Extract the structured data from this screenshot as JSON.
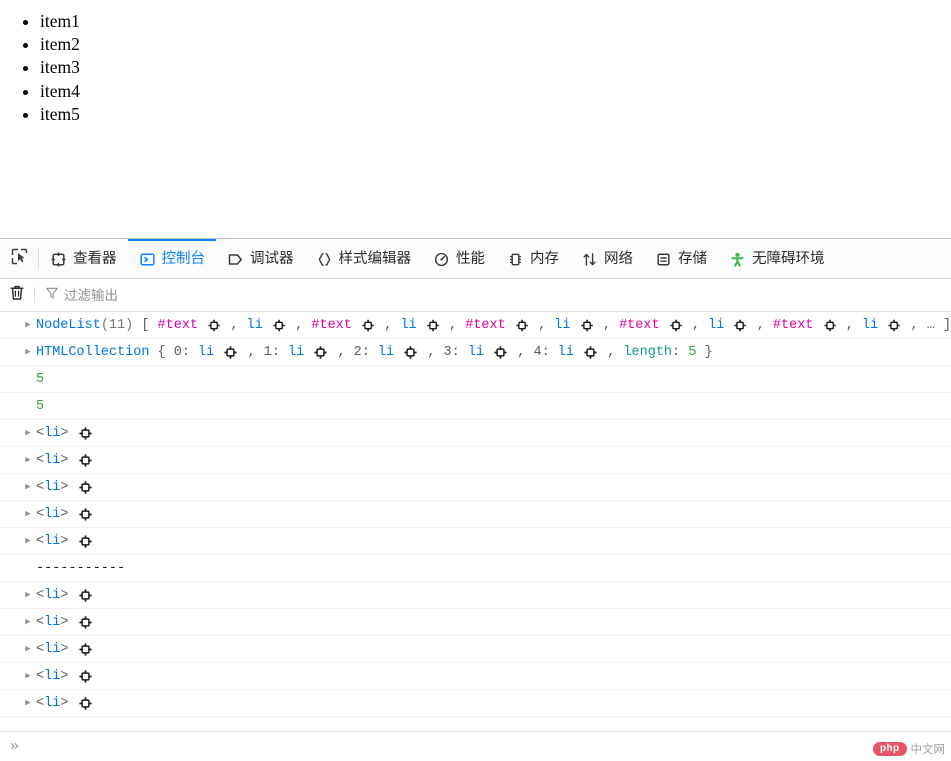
{
  "page": {
    "list_items": [
      "item1",
      "item2",
      "item3",
      "item4",
      "item5"
    ]
  },
  "devtools": {
    "picker_icon": "element-picker-icon",
    "tabs": [
      {
        "label": "查看器",
        "icon": "inspector-target-icon",
        "active": false
      },
      {
        "label": "控制台",
        "icon": "console-prompt-icon",
        "active": true
      },
      {
        "label": "调试器",
        "icon": "debugger-icon",
        "active": false
      },
      {
        "label": "样式编辑器",
        "icon": "braces-icon",
        "active": false
      },
      {
        "label": "性能",
        "icon": "gauge-icon",
        "active": false
      },
      {
        "label": "内存",
        "icon": "memory-icon",
        "active": false
      },
      {
        "label": "网络",
        "icon": "arrows-updown-icon",
        "active": false
      },
      {
        "label": "存储",
        "icon": "storage-icon",
        "active": false
      },
      {
        "label": "无障碍环境",
        "icon": "accessibility-person-icon",
        "active": false
      }
    ],
    "filterbar": {
      "trash_icon": "trash-icon",
      "funnel_icon": "filter-funnel-icon",
      "filter_placeholder": "过滤输出",
      "filter_value": ""
    },
    "prompt": {
      "chevron": "»",
      "value": "",
      "placeholder": ""
    }
  },
  "console": {
    "rows": [
      {
        "type": "object",
        "expandable": true,
        "tokens": [
          {
            "text": "NodeList",
            "cls": "t-obj"
          },
          {
            "text": "(11)",
            "cls": "t-count"
          },
          {
            "text": " [ ",
            "cls": "t-punct"
          },
          {
            "text": "#text",
            "cls": "t-text"
          },
          {
            "text": " ",
            "cls": "t-punct",
            "icon": "inspect-node-icon"
          },
          {
            "text": " , ",
            "cls": "t-punct"
          },
          {
            "text": "li",
            "cls": "t-li"
          },
          {
            "text": " ",
            "cls": "t-punct",
            "icon": "inspect-node-icon"
          },
          {
            "text": " , ",
            "cls": "t-punct"
          },
          {
            "text": "#text",
            "cls": "t-text"
          },
          {
            "text": " ",
            "cls": "t-punct",
            "icon": "inspect-node-icon"
          },
          {
            "text": " , ",
            "cls": "t-punct"
          },
          {
            "text": "li",
            "cls": "t-li"
          },
          {
            "text": " ",
            "cls": "t-punct",
            "icon": "inspect-node-icon"
          },
          {
            "text": " , ",
            "cls": "t-punct"
          },
          {
            "text": "#text",
            "cls": "t-text"
          },
          {
            "text": " ",
            "cls": "t-punct",
            "icon": "inspect-node-icon"
          },
          {
            "text": " , ",
            "cls": "t-punct"
          },
          {
            "text": "li",
            "cls": "t-li"
          },
          {
            "text": " ",
            "cls": "t-punct",
            "icon": "inspect-node-icon"
          },
          {
            "text": " , ",
            "cls": "t-punct"
          },
          {
            "text": "#text",
            "cls": "t-text"
          },
          {
            "text": " ",
            "cls": "t-punct",
            "icon": "inspect-node-icon"
          },
          {
            "text": " , ",
            "cls": "t-punct"
          },
          {
            "text": "li",
            "cls": "t-li"
          },
          {
            "text": " ",
            "cls": "t-punct",
            "icon": "inspect-node-icon"
          },
          {
            "text": " , ",
            "cls": "t-punct"
          },
          {
            "text": "#text",
            "cls": "t-text"
          },
          {
            "text": " ",
            "cls": "t-punct",
            "icon": "inspect-node-icon"
          },
          {
            "text": " , ",
            "cls": "t-punct"
          },
          {
            "text": "li",
            "cls": "t-li"
          },
          {
            "text": " ",
            "cls": "t-punct",
            "icon": "inspect-node-icon"
          },
          {
            "text": " , ",
            "cls": "t-punct"
          },
          {
            "text": "… ]",
            "cls": "t-punct"
          }
        ]
      },
      {
        "type": "object",
        "expandable": true,
        "tokens": [
          {
            "text": "HTMLCollection",
            "cls": "t-obj"
          },
          {
            "text": " { ",
            "cls": "t-punct"
          },
          {
            "text": "0",
            "cls": "t-punct"
          },
          {
            "text": ": ",
            "cls": "t-punct"
          },
          {
            "text": "li",
            "cls": "t-li"
          },
          {
            "text": " ",
            "cls": "t-punct",
            "icon": "inspect-node-icon"
          },
          {
            "text": " , ",
            "cls": "t-punct"
          },
          {
            "text": "1",
            "cls": "t-punct"
          },
          {
            "text": ": ",
            "cls": "t-punct"
          },
          {
            "text": "li",
            "cls": "t-li"
          },
          {
            "text": " ",
            "cls": "t-punct",
            "icon": "inspect-node-icon"
          },
          {
            "text": " , ",
            "cls": "t-punct"
          },
          {
            "text": "2",
            "cls": "t-punct"
          },
          {
            "text": ": ",
            "cls": "t-punct"
          },
          {
            "text": "li",
            "cls": "t-li"
          },
          {
            "text": " ",
            "cls": "t-punct",
            "icon": "inspect-node-icon"
          },
          {
            "text": " , ",
            "cls": "t-punct"
          },
          {
            "text": "3",
            "cls": "t-punct"
          },
          {
            "text": ": ",
            "cls": "t-punct"
          },
          {
            "text": "li",
            "cls": "t-li"
          },
          {
            "text": " ",
            "cls": "t-punct",
            "icon": "inspect-node-icon"
          },
          {
            "text": " , ",
            "cls": "t-punct"
          },
          {
            "text": "4",
            "cls": "t-punct"
          },
          {
            "text": ": ",
            "cls": "t-punct"
          },
          {
            "text": "li",
            "cls": "t-li"
          },
          {
            "text": " ",
            "cls": "t-punct",
            "icon": "inspect-node-icon"
          },
          {
            "text": " , ",
            "cls": "t-punct"
          },
          {
            "text": "length",
            "cls": "t-key"
          },
          {
            "text": ": ",
            "cls": "t-punct"
          },
          {
            "text": "5",
            "cls": "t-num"
          },
          {
            "text": " }",
            "cls": "t-punct"
          }
        ]
      },
      {
        "type": "number",
        "expandable": false,
        "tokens": [
          {
            "text": "5",
            "cls": "t-num"
          }
        ]
      },
      {
        "type": "number",
        "expandable": false,
        "tokens": [
          {
            "text": "5",
            "cls": "t-num"
          }
        ]
      },
      {
        "type": "node",
        "expandable": true,
        "tokens": [
          {
            "text": "<",
            "cls": "t-tagbr"
          },
          {
            "text": "li",
            "cls": "t-li"
          },
          {
            "text": ">",
            "cls": "t-tagbr"
          },
          {
            "text": " ",
            "cls": "t-punct",
            "icon": "inspect-node-icon"
          }
        ]
      },
      {
        "type": "node",
        "expandable": true,
        "tokens": [
          {
            "text": "<",
            "cls": "t-tagbr"
          },
          {
            "text": "li",
            "cls": "t-li"
          },
          {
            "text": ">",
            "cls": "t-tagbr"
          },
          {
            "text": " ",
            "cls": "t-punct",
            "icon": "inspect-node-icon"
          }
        ]
      },
      {
        "type": "node",
        "expandable": true,
        "tokens": [
          {
            "text": "<",
            "cls": "t-tagbr"
          },
          {
            "text": "li",
            "cls": "t-li"
          },
          {
            "text": ">",
            "cls": "t-tagbr"
          },
          {
            "text": " ",
            "cls": "t-punct",
            "icon": "inspect-node-icon"
          }
        ]
      },
      {
        "type": "node",
        "expandable": true,
        "tokens": [
          {
            "text": "<",
            "cls": "t-tagbr"
          },
          {
            "text": "li",
            "cls": "t-li"
          },
          {
            "text": ">",
            "cls": "t-tagbr"
          },
          {
            "text": " ",
            "cls": "t-punct",
            "icon": "inspect-node-icon"
          }
        ]
      },
      {
        "type": "node",
        "expandable": true,
        "tokens": [
          {
            "text": "<",
            "cls": "t-tagbr"
          },
          {
            "text": "li",
            "cls": "t-li"
          },
          {
            "text": ">",
            "cls": "t-tagbr"
          },
          {
            "text": " ",
            "cls": "t-punct",
            "icon": "inspect-node-icon"
          }
        ]
      },
      {
        "type": "text",
        "expandable": false,
        "tokens": [
          {
            "text": "-----------",
            "cls": "t-dash"
          }
        ]
      },
      {
        "type": "node",
        "expandable": true,
        "tokens": [
          {
            "text": "<",
            "cls": "t-tagbr"
          },
          {
            "text": "li",
            "cls": "t-li"
          },
          {
            "text": ">",
            "cls": "t-tagbr"
          },
          {
            "text": " ",
            "cls": "t-punct",
            "icon": "inspect-node-icon"
          }
        ]
      },
      {
        "type": "node",
        "expandable": true,
        "tokens": [
          {
            "text": "<",
            "cls": "t-tagbr"
          },
          {
            "text": "li",
            "cls": "t-li"
          },
          {
            "text": ">",
            "cls": "t-tagbr"
          },
          {
            "text": " ",
            "cls": "t-punct",
            "icon": "inspect-node-icon"
          }
        ]
      },
      {
        "type": "node",
        "expandable": true,
        "tokens": [
          {
            "text": "<",
            "cls": "t-tagbr"
          },
          {
            "text": "li",
            "cls": "t-li"
          },
          {
            "text": ">",
            "cls": "t-tagbr"
          },
          {
            "text": " ",
            "cls": "t-punct",
            "icon": "inspect-node-icon"
          }
        ]
      },
      {
        "type": "node",
        "expandable": true,
        "tokens": [
          {
            "text": "<",
            "cls": "t-tagbr"
          },
          {
            "text": "li",
            "cls": "t-li"
          },
          {
            "text": ">",
            "cls": "t-tagbr"
          },
          {
            "text": " ",
            "cls": "t-punct",
            "icon": "inspect-node-icon"
          }
        ]
      },
      {
        "type": "node",
        "expandable": true,
        "tokens": [
          {
            "text": "<",
            "cls": "t-tagbr"
          },
          {
            "text": "li",
            "cls": "t-li"
          },
          {
            "text": ">",
            "cls": "t-tagbr"
          },
          {
            "text": " ",
            "cls": "t-punct",
            "icon": "inspect-node-icon"
          }
        ]
      }
    ]
  },
  "watermark": {
    "badge": "php",
    "text": "中文网"
  },
  "colors": {
    "accent": "#0a84ff",
    "object": "#0074e8",
    "text_node": "#dd00a9",
    "number": "#30a142",
    "key": "#0e9b8d",
    "watermark_badge": "#e8455a"
  }
}
